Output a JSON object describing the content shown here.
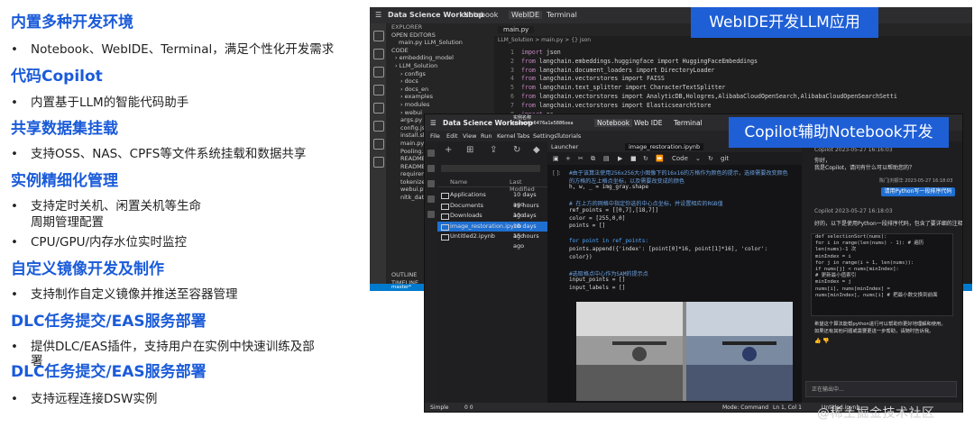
{
  "left": {
    "sections": [
      {
        "title": "内置多种开发环境",
        "bullets": [
          "Notebook、WebIDE、Terminal，满足个性化开发需求"
        ]
      },
      {
        "title": "代码Copilot",
        "bullets": [
          "内置基于LLM的智能代码助手"
        ]
      },
      {
        "title": "共享数据集挂载",
        "bullets": [
          "支持OSS、NAS、CPFS等文件系统挂载和数据共享"
        ]
      },
      {
        "title": "实例精细化管理",
        "bullets": [
          "支持定时关机、闲置关机等生命",
          "周期管理配置",
          "CPU/GPU/内存水位实时监控"
        ]
      },
      {
        "title": "自定义镜像开发及制作",
        "bullets": [
          "支持制作自定义镜像并推送至容器管理"
        ]
      },
      {
        "title": "DLC任务提交/EAS服务部署",
        "bullets": [
          "提供DLC/EAS插件，支持用户在实例中快速训练及部",
          "署"
        ]
      },
      {
        "title": "DLC任务提交/EAS服务部署",
        "bullets": [
          "支持远程连接DSW实例"
        ]
      }
    ]
  },
  "badges": {
    "webide": "WebIDE开发LLM应用",
    "copilot": "Copilot辅助Notebook开发"
  },
  "vscode": {
    "title": "Data Science Workshop",
    "tabs": [
      "Notebook",
      "WebIDE",
      "Terminal"
    ],
    "explorer_label": "EXPLORER",
    "open_editors": "OPEN EDITORS",
    "open_file": "main.py  LLM_Solution",
    "code_label": "CODE",
    "tree": [
      "embedding_model",
      "LLM_Solution",
      "configs",
      "docs",
      "docs_en",
      "examples",
      "modules",
      "webui",
      "args.py",
      "config.json",
      "install.sh",
      "main.py",
      "Pooling.py",
      "README_m",
      "README.m",
      "requiremen",
      "tokenizer.m",
      "webui.py",
      "nltk_data"
    ],
    "outline": "OUTLINE",
    "timeline": "TIMELINE",
    "editor_tab": "main.py",
    "breadcrumb": "LLM_Solution > main.py > {} json",
    "code": [
      {
        "n": "1",
        "kw": "import",
        "rest": " json"
      },
      {
        "n": "2",
        "kw": "from",
        "rest": " langchain.embeddings.huggingface import HuggingFaceEmbeddings"
      },
      {
        "n": "3",
        "kw": "from",
        "rest": " langchain.document_loaders import DirectoryLoader"
      },
      {
        "n": "4",
        "kw": "from",
        "rest": " langchain.vectorstores import FAISS"
      },
      {
        "n": "5",
        "kw": "from",
        "rest": " langchain.text_splitter import CharacterTextSplitter"
      },
      {
        "n": "6",
        "kw": "from",
        "rest": " langchain.vectorstores import AnalyticDB,Hologres,AlibabaCloudOpenSearch,AlibabaCloudOpenSearchSetti"
      },
      {
        "n": "7",
        "kw": "from",
        "rest": " langchain.vectorstores import ElasticsearchStore"
      },
      {
        "n": "8",
        "kw": "import",
        "rest": " os"
      },
      {
        "n": "9",
        "kw": "import",
        "rest": " logging"
      },
      {
        "n": "10",
        "kw": "import",
        "rest": " time"
      }
    ],
    "status": "master*"
  },
  "notebook": {
    "title": "Data Science Workshop",
    "instance": "实例名称\ntrooest-e6476a1e5886oea",
    "tabs": [
      "Notebook",
      "Web IDE",
      "Terminal"
    ],
    "menu": [
      "File",
      "Edit",
      "View",
      "Run",
      "Kernel",
      "Tabs",
      "Settings",
      "Tutorials"
    ],
    "fb_headers": {
      "name": "Name",
      "modified": "Last Modified"
    },
    "files": [
      {
        "name": "Applications",
        "modified": "10 days ago",
        "selected": false
      },
      {
        "name": "Documents",
        "modified": "15 hours ago",
        "selected": false
      },
      {
        "name": "Downloads",
        "modified": "10 days ago",
        "selected": false
      },
      {
        "name": "image_restoration.ipynb",
        "modified": "10 days ago",
        "selected": true
      },
      {
        "name": "Untitled2.ipynb",
        "modified": "15 hours ago",
        "selected": false
      }
    ],
    "doc_tabs": [
      "Launcher",
      "image_restoration.ipynb"
    ],
    "cell_type": "Code",
    "prompt": "[ ]:",
    "cell_lines": [
      {
        "c": "cm",
        "t": "#由于该算法使用256x256大小图像下的16x16的方格作为颜色的提示，选择需要改变颜色"
      },
      {
        "c": "cm",
        "t": "的方格的左上格点坐标，以及需要改变成的颜色"
      },
      {
        "c": "",
        "t": "h, w, _ = img_gray.shape"
      },
      {
        "c": "",
        "t": ""
      },
      {
        "c": "cm",
        "t": "# 在上方的网格中指定你选的中心点坐标，并设置相应的RGB值"
      },
      {
        "c": "",
        "t": "ref_points = [[0,7],[18,7]]"
      },
      {
        "c": "",
        "t": "color = [255,0,0]"
      },
      {
        "c": "",
        "t": "points = []"
      },
      {
        "c": "",
        "t": ""
      },
      {
        "c": "k2",
        "t": "for point in ref_points:"
      },
      {
        "c": "",
        "t": "    points.append({'index': [point[0]*16, point[1]*16], 'color':"
      },
      {
        "c": "",
        "t": "color})"
      },
      {
        "c": "",
        "t": ""
      },
      {
        "c": "cm",
        "t": "#选取格点中心作为SAM的提示点"
      },
      {
        "c": "",
        "t": "input_points = []"
      },
      {
        "c": "",
        "t": "input_labels = []"
      }
    ],
    "status": {
      "mode": "Simple",
      "counts": "0  0",
      "right": "Mode: Command",
      "pos": "Ln 1, Col 1",
      "file": "Untitled.ipynb"
    }
  },
  "copilot": {
    "header": "Copilot 2023-05-27 16:16:03",
    "greeting": "你好，",
    "greeting2": "我是Copilot，请问有什么可以帮助您的？",
    "user_meta": "陈门|刘振华 2023-05-27 16:18:03",
    "user_msg": "请用Python写一段排序代码",
    "answer_meta": "Copilot 2023-05-27 16:18:03",
    "answer_intro": "好的，以下是使用Python一段排序代码，包含了要详细的注释说明：",
    "code": [
      "def selectionSort(nums):",
      "    for i in range(len(nums) - 1):  # 遍历",
      "len(nums)-1 次",
      "        minIndex = i",
      "        for j in range(i + 1, len(nums)):",
      "            if nums[j] < nums[minIndex]:",
      "    # 更新最小值索引",
      "                minIndex = j",
      "        nums[i], nums[minIndex] =",
      "nums[minIndex], nums[i] # 把最小数交换到前面",
      ""
    ],
    "footer1": "希望这个算法能帮python进行可以帮助你更好地理解和使用。",
    "footer2": "如果还有其他问题或需要更进一步帮助，请随时告诉我。",
    "input_placeholder": "正在输出中..."
  },
  "watermark": "@稀土掘金技术社区"
}
